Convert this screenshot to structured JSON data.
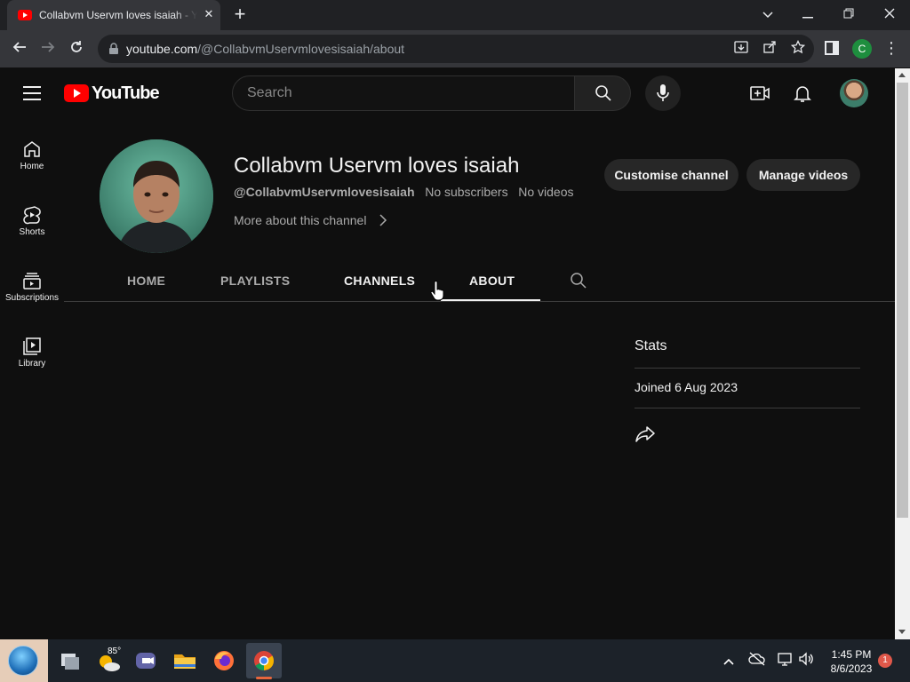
{
  "browser": {
    "tab_title": "Collabvm Uservm loves isaiah - YouTube",
    "tab_close": "✕",
    "new_tab": "+",
    "url_host": "youtube.com",
    "url_path": "/@CollabvmUservmlovesisaiah/about",
    "profile_letter": "C",
    "menu_glyph": "⋮"
  },
  "masthead": {
    "logo_text": "YouTube",
    "search_placeholder": "Search"
  },
  "guide": {
    "items": [
      {
        "label": "Home",
        "icon": "home-icon"
      },
      {
        "label": "Shorts",
        "icon": "shorts-icon"
      },
      {
        "label": "Subscriptions",
        "icon": "subscriptions-icon"
      },
      {
        "label": "Library",
        "icon": "library-icon"
      }
    ]
  },
  "channel": {
    "name": "Collabvm Uservm loves isaiah",
    "handle": "@CollabvmUservmlovesisaiah",
    "subscribers": "No subscribers",
    "videos": "No videos",
    "more_about": "More about this channel",
    "customise_label": "Customise channel",
    "manage_label": "Manage videos"
  },
  "tabs": [
    {
      "label": "HOME",
      "active": false
    },
    {
      "label": "PLAYLISTS",
      "active": false
    },
    {
      "label": "CHANNELS",
      "active": false
    },
    {
      "label": "ABOUT",
      "active": true
    }
  ],
  "about": {
    "stats_title": "Stats",
    "joined": "Joined 6 Aug 2023"
  },
  "taskbar": {
    "weather_temp": "85°",
    "time": "1:45 PM",
    "date": "8/6/2023",
    "notifications": "1"
  },
  "colors": {
    "youtube_red": "#ff0000",
    "background": "#0f0f0f",
    "chip": "#272727"
  }
}
